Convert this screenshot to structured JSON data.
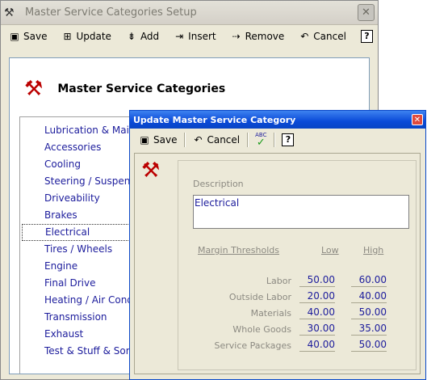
{
  "main_window": {
    "title": "Master Service Categories Setup",
    "toolbar": {
      "save": "Save",
      "update": "Update",
      "add": "Add",
      "insert": "Insert",
      "remove": "Remove",
      "cancel": "Cancel",
      "help": "?"
    },
    "heading": "Master Service Categories",
    "categories": [
      "Lubrication & Maint",
      "Accessories",
      "Cooling",
      "Steering / Suspens",
      "Driveability",
      "Brakes",
      "Electrical",
      "Tires / Wheels",
      "Engine",
      "Final Drive",
      "Heating / Air Cond",
      "Transmission",
      "Exhaust",
      "Test & Stuff & Som"
    ],
    "selected_category": "Electrical"
  },
  "dialog": {
    "title": "Update Master Service Category",
    "toolbar": {
      "save": "Save",
      "cancel": "Cancel",
      "spellcheck": "ABC",
      "help": "?"
    },
    "description_label": "Description",
    "description_value": "Electrical",
    "margin_header": "Margin Thresholds",
    "low_header": "Low",
    "high_header": "High",
    "thresholds": [
      {
        "label": "Labor",
        "low": "50.00",
        "high": "60.00"
      },
      {
        "label": "Outside Labor",
        "low": "20.00",
        "high": "40.00"
      },
      {
        "label": "Materials",
        "low": "40.00",
        "high": "50.00"
      },
      {
        "label": "Whole Goods",
        "low": "30.00",
        "high": "35.00"
      },
      {
        "label": "Service Packages",
        "low": "40.00",
        "high": "50.00"
      }
    ]
  },
  "icons": {
    "app": "tools-icon",
    "save": "floppy-disk-icon",
    "update": "update-icon",
    "add": "add-row-icon",
    "insert": "insert-row-icon",
    "remove": "remove-row-icon",
    "cancel": "undo-icon",
    "help": "help-icon",
    "spellcheck": "spellcheck-icon"
  },
  "colors": {
    "dialog_title_bar": "#0a4ad8",
    "list_text": "#1c1c9c",
    "window_bg": "#ece9d8",
    "close_button": "#e04a3c"
  }
}
